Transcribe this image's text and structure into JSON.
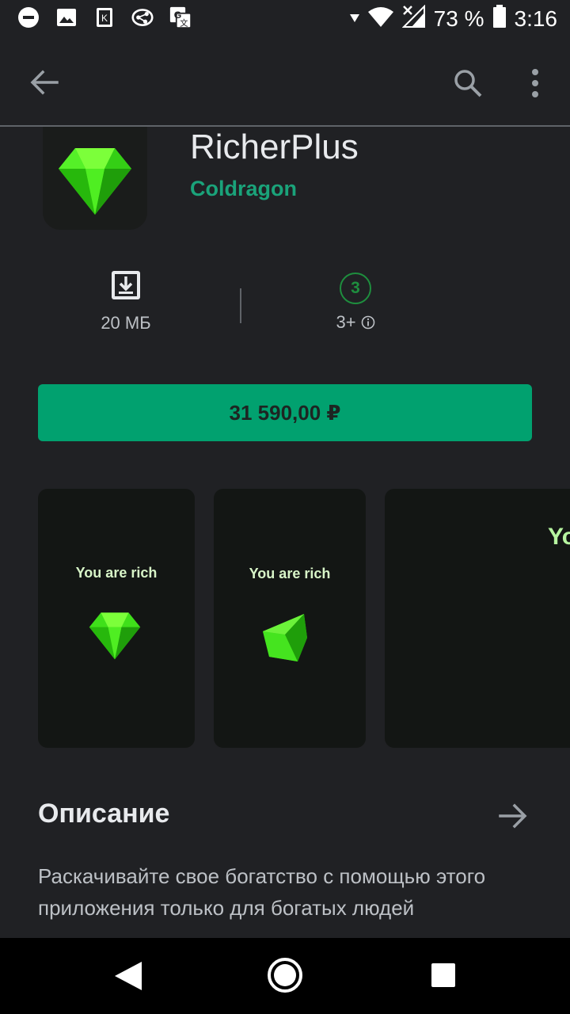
{
  "status_bar": {
    "battery_percent": "73 %",
    "time": "3:16",
    "icons": [
      "dnd-icon",
      "image-icon",
      "kinopoisk-icon",
      "vpn-icon",
      "translate-icon",
      "wifi-icon",
      "signal-icon",
      "battery-icon"
    ]
  },
  "app_bar": {
    "icons": [
      "back-arrow-icon",
      "search-icon",
      "more-vert-icon"
    ]
  },
  "app": {
    "title": "RicherPlus",
    "developer": "Coldragon",
    "icon": "green-gem-icon",
    "accent_color": "#1aa37a"
  },
  "stats": {
    "size": "20 МБ",
    "age_rating_badge": "3",
    "age_rating": "3+"
  },
  "buy_button": {
    "label": "31 590,00 ₽",
    "color": "#01a16f"
  },
  "screenshots": [
    {
      "caption": "You are rich"
    },
    {
      "caption": "You are rich"
    },
    {
      "caption": "Yo"
    }
  ],
  "description": {
    "title": "Описание",
    "text": "Раскачивайте свое богатство с помощью этого приложения только для богатых людей"
  },
  "nav_bar": {
    "icons": [
      "nav-back-icon",
      "nav-home-icon",
      "nav-recents-icon"
    ]
  }
}
